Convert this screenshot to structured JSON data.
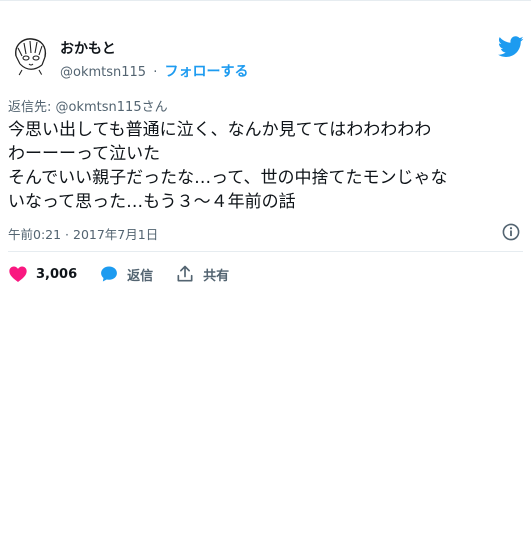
{
  "user": {
    "display_name": "おかもと",
    "handle": "@okmtsn115",
    "separator": "·",
    "follow_label": "フォローする"
  },
  "reply": {
    "prefix": "返信先: ",
    "handle": "@okmtsn115",
    "suffix": "さん"
  },
  "tweet": {
    "text": "今思い出しても普通に泣く、なんか見ててはわわわわわ\nわーーーって泣いた\nそんでいい親子だったな…って、世の中捨てたモンじゃな\nいなって思った…もう３～４年前の話",
    "timestamp": "午前0:21 · 2017年7月1日"
  },
  "actions": {
    "like_count": "3,006",
    "reply_label": "返信",
    "share_label": "共有"
  },
  "colors": {
    "accent": "#1d9bf0",
    "like": "#f91880",
    "text": "#0f1419",
    "secondary": "#536471",
    "border": "#e6ecf0"
  },
  "icons": {
    "brand": "twitter-bird-icon",
    "info": "info-icon",
    "like": "heart-icon",
    "reply": "speech-bubble-icon",
    "share": "share-upload-icon"
  }
}
